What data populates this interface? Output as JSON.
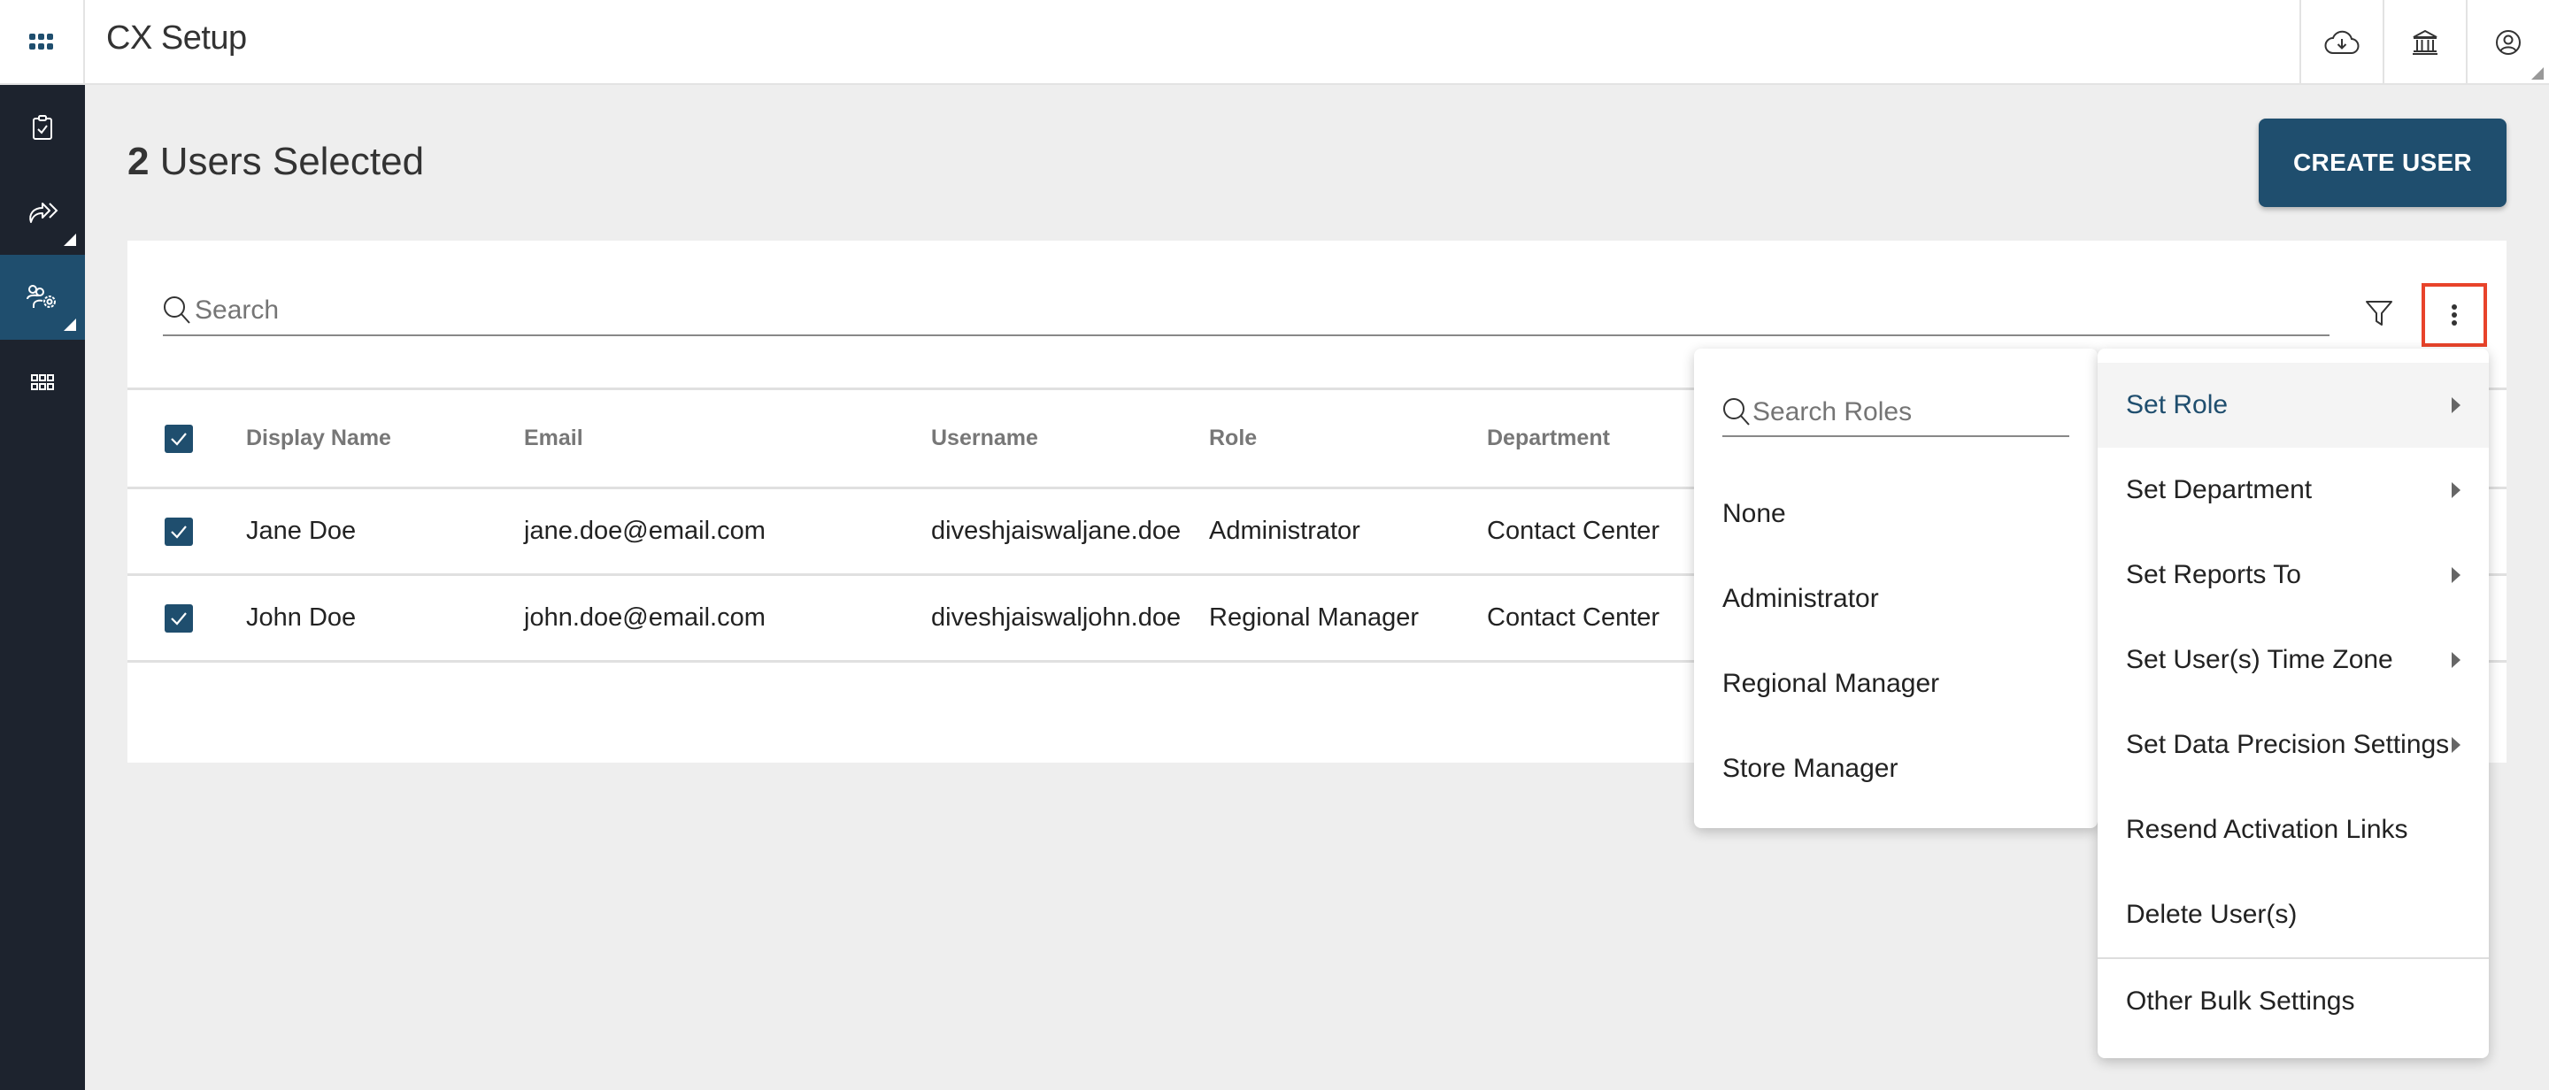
{
  "header": {
    "title": "CX Setup",
    "icons": [
      "cloud-download-icon",
      "bank-icon",
      "user-account-icon"
    ]
  },
  "sidebar": {
    "items": [
      {
        "icon": "clipboard-check-icon",
        "active": false,
        "expandable": false
      },
      {
        "icon": "forward-share-icon",
        "active": false,
        "expandable": true
      },
      {
        "icon": "users-settings-icon",
        "active": true,
        "expandable": true
      },
      {
        "icon": "apps-grid-icon",
        "active": false,
        "expandable": false
      }
    ]
  },
  "page": {
    "selected_count": "2",
    "selected_label": "Users Selected",
    "create_button": "CREATE USER"
  },
  "search": {
    "placeholder": "Search",
    "value": ""
  },
  "table": {
    "columns": [
      "Display Name",
      "Email",
      "Username",
      "Role",
      "Department"
    ],
    "header_checked": true,
    "rows": [
      {
        "checked": true,
        "display_name": "Jane Doe",
        "email": "jane.doe@email.com",
        "username": "diveshjaiswaljane.doe",
        "role": "Administrator",
        "department": "Contact Center"
      },
      {
        "checked": true,
        "display_name": "John Doe",
        "email": "john.doe@email.com",
        "username": "diveshjaiswaljohn.doe",
        "role": "Regional Manager",
        "department": "Contact Center"
      }
    ]
  },
  "roles_menu": {
    "search_placeholder": "Search Roles",
    "options": [
      "None",
      "Administrator",
      "Regional Manager",
      "Store Manager"
    ]
  },
  "actions_menu": {
    "items": [
      {
        "label": "Set Role",
        "submenu": true,
        "active": true
      },
      {
        "label": "Set Department",
        "submenu": true,
        "active": false
      },
      {
        "label": "Set Reports To",
        "submenu": true,
        "active": false
      },
      {
        "label": "Set User(s) Time Zone",
        "submenu": true,
        "active": false
      },
      {
        "label": "Set Data Precision Settings",
        "submenu": true,
        "active": false
      },
      {
        "label": "Resend Activation Links",
        "submenu": false,
        "active": false
      },
      {
        "label": "Delete User(s)",
        "submenu": false,
        "active": false
      },
      {
        "label": "Other Bulk Settings",
        "submenu": false,
        "active": false
      }
    ]
  },
  "colors": {
    "brand": "#1f4e6e",
    "sidebar_bg": "#1d232e",
    "highlight_border": "#e8432a"
  }
}
